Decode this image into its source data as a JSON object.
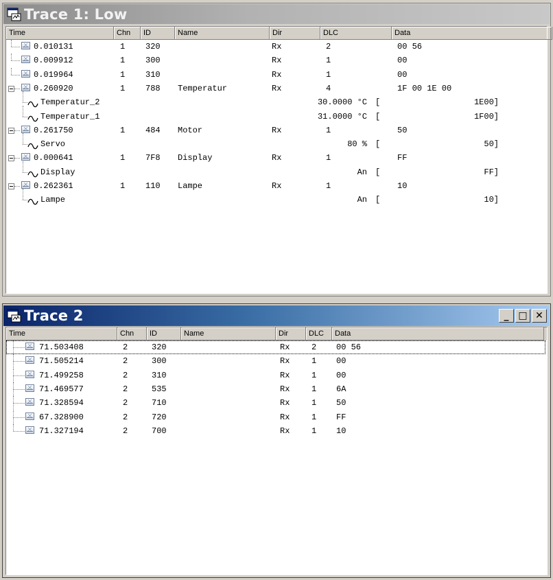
{
  "trace1": {
    "title": "Trace 1: Low",
    "columns": [
      "Time",
      "Chn",
      "ID",
      "Name",
      "Dir",
      "DLC",
      "Data"
    ],
    "rows": [
      {
        "kind": "msg",
        "time": "0.010131",
        "chn": "1",
        "id": "320",
        "name": "",
        "dir": "Rx",
        "dlc": "2",
        "data": "00 56"
      },
      {
        "kind": "msg",
        "time": "0.009912",
        "chn": "1",
        "id": "300",
        "name": "",
        "dir": "Rx",
        "dlc": "1",
        "data": "00"
      },
      {
        "kind": "msg",
        "time": "0.019964",
        "chn": "1",
        "id": "310",
        "name": "",
        "dir": "Rx",
        "dlc": "1",
        "data": "00"
      },
      {
        "kind": "msg",
        "time": "0.260920",
        "chn": "1",
        "id": "788",
        "name": "Temperatur",
        "dir": "Rx",
        "dlc": "4",
        "data": "1F 00 1E 00"
      },
      {
        "kind": "sig",
        "name": "Temperatur_2",
        "value": "30.0000 °C",
        "bracket": "[",
        "raw": "1E00]"
      },
      {
        "kind": "sig",
        "name": "Temperatur_1",
        "value": "31.0000 °C",
        "bracket": "[",
        "raw": "1F00]"
      },
      {
        "kind": "msg",
        "time": "0.261750",
        "chn": "1",
        "id": "484",
        "name": "Motor",
        "dir": "Rx",
        "dlc": "1",
        "data": "50"
      },
      {
        "kind": "sig",
        "name": "Servo",
        "value": "80 %",
        "bracket": "[",
        "raw": "50]"
      },
      {
        "kind": "msg",
        "time": "0.000641",
        "chn": "1",
        "id": "7F8",
        "name": "Display",
        "dir": "Rx",
        "dlc": "1",
        "data": "FF"
      },
      {
        "kind": "sig",
        "name": "Display",
        "value": "An",
        "bracket": "[",
        "raw": "FF]"
      },
      {
        "kind": "msg",
        "time": "0.262361",
        "chn": "1",
        "id": "110",
        "name": "Lampe",
        "dir": "Rx",
        "dlc": "1",
        "data": "10"
      },
      {
        "kind": "sig",
        "name": "Lampe",
        "value": "An",
        "bracket": "[",
        "raw": "10]"
      }
    ]
  },
  "trace2": {
    "title": "Trace 2",
    "buttons": {
      "minimize": "_",
      "maximize": "□",
      "close": "✕"
    },
    "columns": [
      "Time",
      "Chn",
      "ID",
      "Name",
      "Dir",
      "DLC",
      "Data"
    ],
    "rows": [
      {
        "time": "71.503408",
        "chn": "2",
        "id": "320",
        "name": "",
        "dir": "Rx",
        "dlc": "2",
        "data": "00 56"
      },
      {
        "time": "71.505214",
        "chn": "2",
        "id": "300",
        "name": "",
        "dir": "Rx",
        "dlc": "1",
        "data": "00"
      },
      {
        "time": "71.499258",
        "chn": "2",
        "id": "310",
        "name": "",
        "dir": "Rx",
        "dlc": "1",
        "data": "00"
      },
      {
        "time": "71.469577",
        "chn": "2",
        "id": "535",
        "name": "",
        "dir": "Rx",
        "dlc": "1",
        "data": "6A"
      },
      {
        "time": "71.328594",
        "chn": "2",
        "id": "710",
        "name": "",
        "dir": "Rx",
        "dlc": "1",
        "data": "50"
      },
      {
        "time": "67.328900",
        "chn": "2",
        "id": "720",
        "name": "",
        "dir": "Rx",
        "dlc": "1",
        "data": "FF"
      },
      {
        "time": "71.327194",
        "chn": "2",
        "id": "700",
        "name": "",
        "dir": "Rx",
        "dlc": "1",
        "data": "10"
      }
    ]
  },
  "icons": {
    "window": "trace-window-icon",
    "message": "can-message-icon",
    "signal": "signal-wave-icon"
  }
}
